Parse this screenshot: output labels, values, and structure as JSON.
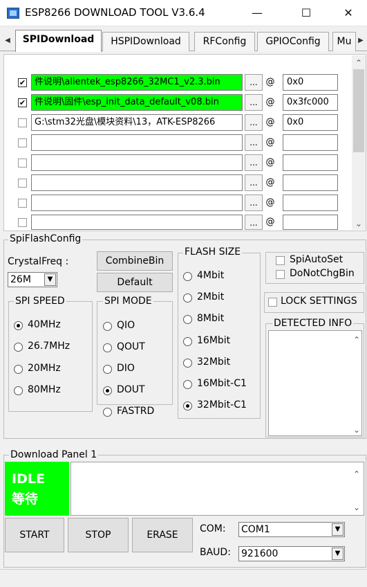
{
  "window": {
    "title": "ESP8266 DOWNLOAD TOOL V3.6.4",
    "minimize": "—",
    "maximize": "☐",
    "close": "✕",
    "icon": "esp-tool-app-icon"
  },
  "tabs": [
    {
      "label": "SPIDownload",
      "active": true
    },
    {
      "label": "HSPIDownload",
      "active": false
    },
    {
      "label": "RFConfig",
      "active": false
    },
    {
      "label": "GPIOConfig",
      "active": false
    },
    {
      "label": "Mu",
      "active": false
    }
  ],
  "tab_arrows": {
    "left": "◀",
    "right": "▶"
  },
  "files": [
    {
      "checked": true,
      "path": "件说明\\alientek_esp8266_32MC1_v2.3.bin",
      "address": "0x0",
      "highlight": true
    },
    {
      "checked": true,
      "path": "件说明\\固件\\esp_init_data_default_v08.bin",
      "address": "0x3fc000",
      "highlight": true
    },
    {
      "checked": false,
      "path": "G:\\stm32光盘\\模块资料\\13，ATK-ESP8266",
      "address": "0x0",
      "highlight": false
    },
    {
      "checked": false,
      "path": "",
      "address": "",
      "highlight": false
    },
    {
      "checked": false,
      "path": "",
      "address": "",
      "highlight": false
    },
    {
      "checked": false,
      "path": "",
      "address": "",
      "highlight": false
    },
    {
      "checked": false,
      "path": "",
      "address": "",
      "highlight": false
    },
    {
      "checked": false,
      "path": "",
      "address": "",
      "highlight": false
    }
  ],
  "browse_label": "...",
  "at_label": "@",
  "check_mark": "✔",
  "scroll_up": "⌃",
  "scroll_down": "⌄",
  "spiflash": {
    "group_label": "SpiFlashConfig",
    "crystal_label": "CrystalFreq :",
    "crystal_value": "26M",
    "combine_button": "CombineBin",
    "default_button": "Default",
    "spi_speed": {
      "label": "SPI SPEED",
      "options": [
        "40MHz",
        "26.7MHz",
        "20MHz",
        "80MHz"
      ],
      "selected": "40MHz"
    },
    "spi_mode": {
      "label": "SPI MODE",
      "options": [
        "QIO",
        "QOUT",
        "DIO",
        "DOUT",
        "FASTRD"
      ],
      "selected": "DOUT"
    },
    "flash_size": {
      "label": "FLASH SIZE",
      "options": [
        "4Mbit",
        "2Mbit",
        "8Mbit",
        "16Mbit",
        "32Mbit",
        "16Mbit-C1",
        "32Mbit-C1"
      ],
      "selected": "32Mbit-C1"
    },
    "spi_auto_set": "SpiAutoSet",
    "do_not_chg_bin": "DoNotChgBin",
    "lock_settings": "LOCK SETTINGS",
    "detected_info": "DETECTED INFO"
  },
  "download": {
    "panel_label": "Download Panel 1",
    "status_en": "IDLE",
    "status_cn": "等待",
    "status_color": "#00ff00",
    "start_button": "START",
    "stop_button": "STOP",
    "erase_button": "ERASE",
    "com_label": "COM:",
    "com_value": "COM1",
    "baud_label": "BAUD:",
    "baud_value": "921600"
  },
  "colors": {
    "highlight_green": "#00ff00",
    "window_bg": "#f0f0f0"
  }
}
